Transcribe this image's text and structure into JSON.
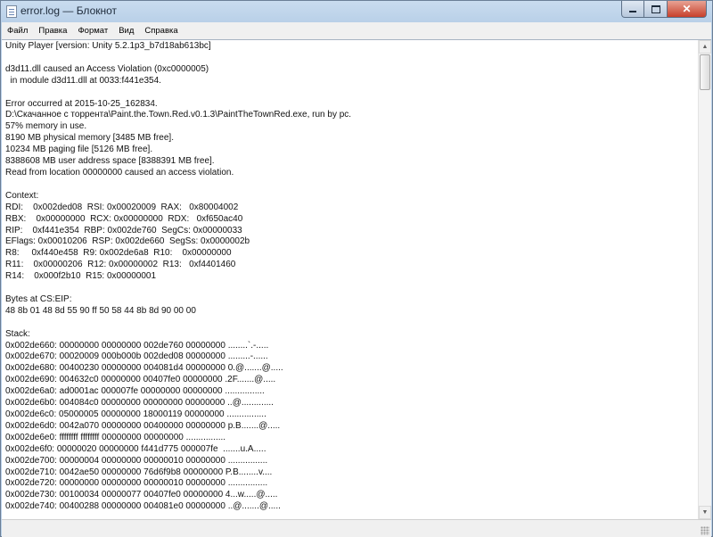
{
  "window": {
    "title": "error.log — Блокнот"
  },
  "controls": {
    "minimize": "",
    "maximize": "",
    "close": "✕"
  },
  "menu": [
    "Файл",
    "Правка",
    "Формат",
    "Вид",
    "Справка"
  ],
  "scrollbar": {
    "up": "▲",
    "down": "▼"
  },
  "editor": {
    "lines": [
      "Unity Player [version: Unity 5.2.1p3_b7d18ab613bc]",
      "",
      "d3d11.dll caused an Access Violation (0xc0000005)",
      "  in module d3d11.dll at 0033:f441e354.",
      "",
      "Error occurred at 2015-10-25_162834.",
      "D:\\Скачанное с торрента\\Paint.the.Town.Red.v0.1.3\\PaintTheTownRed.exe, run by pc.",
      "57% memory in use.",
      "8190 MB physical memory [3485 MB free].",
      "10234 MB paging file [5126 MB free].",
      "8388608 MB user address space [8388391 MB free].",
      "Read from location 00000000 caused an access violation.",
      "",
      "Context:",
      "RDI:    0x002ded08  RSI: 0x00020009  RAX:   0x80004002",
      "RBX:    0x00000000  RCX: 0x00000000  RDX:   0xf650ac40",
      "RIP:    0xf441e354  RBP: 0x002de760  SegCs: 0x00000033",
      "EFlags: 0x00010206  RSP: 0x002de660  SegSs: 0x0000002b",
      "R8:     0xf440e458  R9: 0x002de6a8  R10:    0x00000000",
      "R11:    0x00000206  R12: 0x00000002  R13:   0xf4401460",
      "R14:    0x000f2b10  R15: 0x00000001",
      "",
      "Bytes at CS:EIP:",
      "48 8b 01 48 8d 55 90 ff 50 58 44 8b 8d 90 00 00",
      "",
      "Stack:",
      "0x002de660: 00000000 00000000 002de760 00000000 ........`.-.....",
      "0x002de670: 00020009 000b000b 002ded08 00000000 .........-......",
      "0x002de680: 00400230 00000000 004081d4 00000000 0.@.......@.....",
      "0x002de690: 004632c0 00000000 00407fe0 00000000 .2F.......@.....",
      "0x002de6a0: ad0001ac 000007fe 00000000 00000000 ................",
      "0x002de6b0: 004084c0 00000000 00000000 00000000 ..@.............",
      "0x002de6c0: 05000005 00000000 18000119 00000000 ................",
      "0x002de6d0: 0042a070 00000000 00400000 00000000 p.B.......@.....",
      "0x002de6e0: ffffffff ffffffff 00000000 00000000 ................",
      "0x002de6f0: 00000020 00000000 f441d775 000007fe  .......u.A.....",
      "0x002de700: 00000004 00000000 00000010 00000000 ................",
      "0x002de710: 0042ae50 00000000 76d6f9b8 00000000 P.B........v....",
      "0x002de720: 00000000 00000000 00000010 00000000 ................",
      "0x002de730: 00100034 00000077 00407fe0 00000000 4...w.....@.....",
      "0x002de740: 00400288 00000000 004081e0 00000000 ..@.......@....."
    ]
  }
}
